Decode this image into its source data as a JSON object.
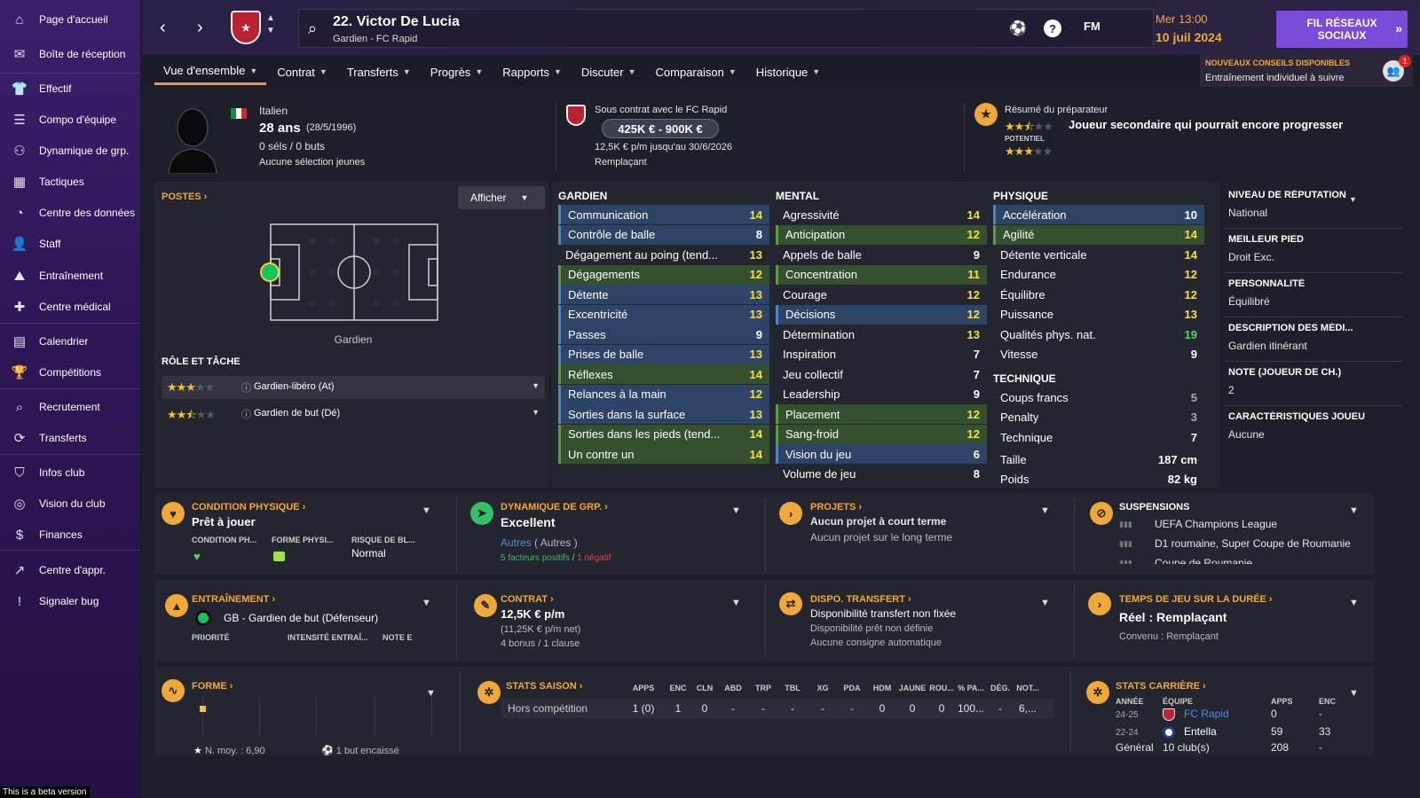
{
  "sidebar": {
    "items": [
      {
        "label": "Page d'accueil",
        "icon": "home-icon"
      },
      {
        "label": "Boîte de réception",
        "icon": "inbox-icon"
      },
      {
        "label": "Effectif",
        "icon": "squad-icon"
      },
      {
        "label": "Compo d'équipe",
        "icon": "lineup-icon"
      },
      {
        "label": "Dynamique de grp.",
        "icon": "dynamics-icon"
      },
      {
        "label": "Tactiques",
        "icon": "tactics-icon"
      },
      {
        "label": "Centre des données",
        "icon": "data-icon"
      },
      {
        "label": "Staff",
        "icon": "staff-icon"
      },
      {
        "label": "Entraînement",
        "icon": "training-icon"
      },
      {
        "label": "Centre médical",
        "icon": "medical-icon"
      },
      {
        "label": "Calendrier",
        "icon": "calendar-icon"
      },
      {
        "label": "Compétitions",
        "icon": "trophy-icon"
      },
      {
        "label": "Recrutement",
        "icon": "scouting-icon"
      },
      {
        "label": "Transferts",
        "icon": "transfers-icon"
      },
      {
        "label": "Infos club",
        "icon": "club-info-icon"
      },
      {
        "label": "Vision du club",
        "icon": "club-vision-icon"
      },
      {
        "label": "Finances",
        "icon": "finances-icon"
      },
      {
        "label": "Centre d'appr.",
        "icon": "dev-centre-icon"
      },
      {
        "label": "Signaler bug",
        "icon": "bug-report-icon"
      }
    ],
    "beta": "This is a beta version"
  },
  "topbar": {
    "player_title": "22. Victor De Lucia",
    "player_sub": "Gardien - FC Rapid",
    "fm_label": "FM",
    "time": "Mer 13:00",
    "date": "10 juil 2024",
    "social_button": "FIL RÉSEAUX SOCIAUX"
  },
  "advice": {
    "title": "NOUVEAUX CONSEILS DISPONIBLES",
    "text": "Entraînement individuel à suivre",
    "count": "1"
  },
  "tabs": [
    "Vue d'ensemble",
    "Contrat",
    "Transferts",
    "Progrès",
    "Rapports",
    "Discuter",
    "Comparaison",
    "Historique"
  ],
  "header": {
    "nationality": "Italien",
    "age": "28 ans",
    "dob": "(28/5/1996)",
    "caps": "0 séls / 0 buts",
    "youth": "Aucune sélection jeunes",
    "contract_with": "Sous contrat avec le FC Rapid",
    "value_range": "425K € - 900K €",
    "wage_line": "12,5K € p/m jusqu'au 30/6/2026",
    "status": "Remplaçant",
    "coach_report_title": "Résumé du préparateur",
    "coach_report_text": "Joueur secondaire qui pourrait encore progresser",
    "potential_label": "POTENTIEL",
    "current_stars": 2.5,
    "potential_stars": 3
  },
  "positions": {
    "title": "POSTES",
    "show_button": "Afficher",
    "position_label": "Gardien",
    "role_title": "RÔLE ET TÂCHE",
    "roles": [
      {
        "name": "Gardien-libéro (At)",
        "stars": 3
      },
      {
        "name": "Gardien de but (Dé)",
        "stars": 2.5
      }
    ]
  },
  "attributes": {
    "goalkeeping": {
      "title": "GARDIEN",
      "rows": [
        {
          "name": "Communication",
          "value": "14",
          "hl": "blue"
        },
        {
          "name": "Contrôle de balle",
          "value": "8",
          "hl": "blue"
        },
        {
          "name": "Dégagement au poing (tend...",
          "value": "13",
          "hl": "plain"
        },
        {
          "name": "Dégagements",
          "value": "12",
          "hl": "green"
        },
        {
          "name": "Détente",
          "value": "13",
          "hl": "blue"
        },
        {
          "name": "Excentricité",
          "value": "13",
          "hl": "blue"
        },
        {
          "name": "Passes",
          "value": "9",
          "hl": "blue"
        },
        {
          "name": "Prises de balle",
          "value": "13",
          "hl": "blue"
        },
        {
          "name": "Réflexes",
          "value": "14",
          "hl": "green"
        },
        {
          "name": "Relances à la main",
          "value": "12",
          "hl": "blue"
        },
        {
          "name": "Sorties dans la surface",
          "value": "13",
          "hl": "blue"
        },
        {
          "name": "Sorties dans les pieds (tend...",
          "value": "14",
          "hl": "green"
        },
        {
          "name": "Un contre un",
          "value": "14",
          "hl": "green"
        }
      ]
    },
    "mental": {
      "title": "MENTAL",
      "rows": [
        {
          "name": "Agressivité",
          "value": "14",
          "hl": "plain"
        },
        {
          "name": "Anticipation",
          "value": "12",
          "hl": "green"
        },
        {
          "name": "Appels de balle",
          "value": "9",
          "hl": "plain"
        },
        {
          "name": "Concentration",
          "value": "11",
          "hl": "green"
        },
        {
          "name": "Courage",
          "value": "12",
          "hl": "plain"
        },
        {
          "name": "Décisions",
          "value": "12",
          "hl": "blue"
        },
        {
          "name": "Détermination",
          "value": "13",
          "hl": "plain"
        },
        {
          "name": "Inspiration",
          "value": "7",
          "hl": "plain"
        },
        {
          "name": "Jeu collectif",
          "value": "7",
          "hl": "plain"
        },
        {
          "name": "Leadership",
          "value": "9",
          "hl": "plain"
        },
        {
          "name": "Placement",
          "value": "12",
          "hl": "green"
        },
        {
          "name": "Sang-froid",
          "value": "12",
          "hl": "green"
        },
        {
          "name": "Vision du jeu",
          "value": "6",
          "hl": "blue"
        },
        {
          "name": "Volume de jeu",
          "value": "8",
          "hl": "plain"
        }
      ]
    },
    "physical": {
      "title": "PHYSIQUE",
      "rows": [
        {
          "name": "Accélération",
          "value": "10",
          "hl": "blue"
        },
        {
          "name": "Agilité",
          "value": "14",
          "hl": "green"
        },
        {
          "name": "Détente verticale",
          "value": "14",
          "hl": "plain"
        },
        {
          "name": "Endurance",
          "value": "12",
          "hl": "plain"
        },
        {
          "name": "Équilibre",
          "value": "12",
          "hl": "plain"
        },
        {
          "name": "Puissance",
          "value": "13",
          "hl": "plain"
        },
        {
          "name": "Qualités phys. nat.",
          "value": "19",
          "hl": "plain"
        },
        {
          "name": "Vitesse",
          "value": "9",
          "hl": "plain"
        }
      ]
    },
    "technical": {
      "title": "TECHNIQUE",
      "rows": [
        {
          "name": "Coups francs",
          "value": "5",
          "hl": "plain"
        },
        {
          "name": "Penalty",
          "value": "3",
          "hl": "plain"
        },
        {
          "name": "Technique",
          "value": "7",
          "hl": "plain"
        }
      ]
    },
    "height_label": "Taille",
    "height": "187 cm",
    "weight_label": "Poids",
    "weight": "82 kg"
  },
  "info": [
    {
      "label": "NIVEAU DE RÉPUTATION",
      "value": "National"
    },
    {
      "label": "MEILLEUR PIED",
      "value": "Droit Exc."
    },
    {
      "label": "PERSONNALITÉ",
      "value": "Équilibré"
    },
    {
      "label": "DESCRIPTION DES MÉDI...",
      "value": "Gardien itinérant"
    },
    {
      "label": "NOTE (JOUEUR DE CH.)",
      "value": "2"
    },
    {
      "label": "CARACTÉRISTIQUES JOUEU",
      "value": "Aucune"
    }
  ],
  "cards": {
    "condition": {
      "title": "CONDITION PHYSIQUE",
      "main": "Prêt à jouer",
      "l1": "CONDITION PH...",
      "l2": "FORME PHYSI...",
      "l3": "RISQUE DE BL...",
      "risk": "Normal"
    },
    "dynamics": {
      "title": "DYNAMIQUE DE GRP.",
      "main": "Excellent",
      "group": "Autres",
      "group2": "( Autres )",
      "pos": "5 facteurs positifs",
      "neg": "1 négatif"
    },
    "projects": {
      "title": "PROJETS",
      "main": "Aucun projet à court terme",
      "sub": "Aucun projet sur le long terme"
    },
    "suspensions": {
      "title": "SUSPENSIONS",
      "items": [
        "UEFA Champions League",
        "D1 roumaine, Super Coupe de Roumanie",
        "Coupe de Roumanie"
      ]
    },
    "training": {
      "title": "ENTRAÎNEMENT",
      "main": "GB - Gardien de but (Défenseur)",
      "l1": "PRIORITÉ",
      "l2": "INTENSITÉ ENTRAÎ...",
      "l3": "NOTE E"
    },
    "contract": {
      "title": "CONTRAT",
      "main": "12,5K € p/m",
      "sub1": "(11,25K € p/m net)",
      "sub2": "4 bonus / 1 clause"
    },
    "transfer": {
      "title": "DISPO. TRANSFERT",
      "main": "Disponibilité transfert non fixée",
      "sub1": "Disponibilité prêt non définie",
      "sub2": "Aucune consigne automatique"
    },
    "playtime": {
      "title": "TEMPS DE JEU SUR LA DURÉE",
      "main": "Réel : Remplaçant",
      "sub": "Convenu : Remplaçant"
    },
    "form": {
      "title": "FORME",
      "avg": "N. moy. : 6,90",
      "conceded": "1 but encaissé"
    },
    "season": {
      "title": "STATS SAISON",
      "headers": [
        "APPS",
        "ENC",
        "CLN",
        "ABD",
        "TRP",
        "TBL",
        "XG",
        "PDA",
        "HDM",
        "JAUNE",
        "ROU...",
        "% PA...",
        "DÉG.",
        "NOT..."
      ],
      "row_label": "Hors compétition",
      "values": [
        "1 (0)",
        "1",
        "0",
        "-",
        "-",
        "-",
        "-",
        "-",
        "0",
        "0",
        "0",
        "100...",
        "-",
        "6,..."
      ]
    },
    "career": {
      "title": "STATS CARRIÈRE",
      "h_year": "ANNÉE",
      "h_team": "ÉQUIPE",
      "h_apps": "APPS",
      "h_enc": "ENC",
      "rows": [
        {
          "year": "24-25",
          "team": "FC Rapid",
          "apps": "0",
          "enc": "-"
        },
        {
          "year": "22-24",
          "team": "Entella",
          "apps": "59",
          "enc": "33"
        }
      ],
      "total_label": "Général",
      "total_clubs": "10 club(s)",
      "total_apps": "208",
      "total_enc": "-"
    }
  },
  "colors": {
    "accent": "#f0a83a",
    "purple": "#7b4ad6",
    "blue_hl": "#2d4466",
    "green_hl": "#35502f"
  }
}
